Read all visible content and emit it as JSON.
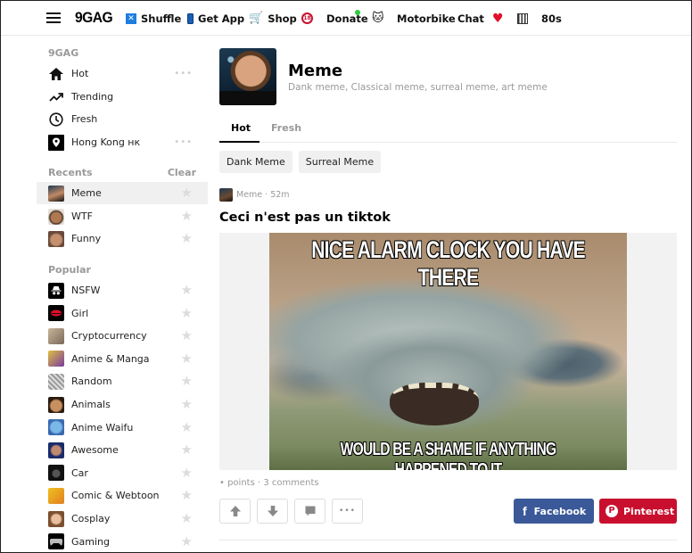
{
  "topbar": {
    "logo": "9GAG",
    "nav": [
      {
        "label": "Shuffle",
        "icon": "shuffle-icon"
      },
      {
        "label": "Get App",
        "icon": "phone-icon"
      },
      {
        "label": "Shop",
        "icon": "cart-icon"
      },
      {
        "label": "",
        "icon": "nsfw-18-icon"
      },
      {
        "label": "Donate",
        "icon": "",
        "notification_dot": true
      },
      {
        "label": "",
        "icon": "cat-icon"
      },
      {
        "label": "Motorbike",
        "icon": ""
      },
      {
        "label": "Chat",
        "icon": ""
      },
      {
        "label": "",
        "icon": "heart-icon"
      },
      {
        "label": "",
        "icon": "piano-icon"
      },
      {
        "label": "80s",
        "icon": ""
      }
    ],
    "glyphs": {
      "shuffle": "✕",
      "cart": "🛒",
      "eighteen": "18",
      "cat": "🐱",
      "heart": "♥"
    }
  },
  "sidebar": {
    "main_title": "9GAG",
    "main_items": [
      {
        "label": "Hot",
        "icon": "home-icon",
        "more": "•••"
      },
      {
        "label": "Trending",
        "icon": "trending-icon"
      },
      {
        "label": "Fresh",
        "icon": "clock-icon"
      },
      {
        "label": "Hong Kong нк",
        "icon": "location-icon",
        "more": "•••"
      }
    ],
    "recents_title": "Recents",
    "clear_label": "Clear",
    "recents": [
      {
        "label": "Meme",
        "active": true
      },
      {
        "label": "WTF"
      },
      {
        "label": "Funny"
      }
    ],
    "popular_title": "Popular",
    "popular": [
      {
        "label": "NSFW"
      },
      {
        "label": "Girl"
      },
      {
        "label": "Cryptocurrency"
      },
      {
        "label": "Anime & Manga"
      },
      {
        "label": "Random"
      },
      {
        "label": "Animals"
      },
      {
        "label": "Anime Waifu"
      },
      {
        "label": "Awesome"
      },
      {
        "label": "Car"
      },
      {
        "label": "Comic & Webtoon"
      },
      {
        "label": "Cosplay"
      },
      {
        "label": "Gaming"
      }
    ],
    "star_glyph": "★"
  },
  "section": {
    "title": "Meme",
    "description": "Dank meme, Classical meme, surreal meme, art meme",
    "tabs": [
      {
        "label": "Hot",
        "active": true
      },
      {
        "label": "Fresh",
        "active": false
      }
    ],
    "chips": [
      "Dank Meme",
      "Surreal Meme"
    ]
  },
  "post": {
    "meta": "Meme · 52m",
    "title": "Ceci n'est pas un tiktok",
    "image_top_text": "NICE ALARM CLOCK YOU HAVE THERE",
    "image_bottom_text": "WOULD BE A SHAME IF ANYTHING HAPPENED TO IT",
    "stats": "• points · 3 comments",
    "actions": {
      "more": "•••"
    },
    "share": {
      "facebook_label": "Facebook",
      "facebook_glyph": "f",
      "pinterest_label": "Pinterest",
      "pinterest_glyph": "P"
    }
  },
  "colors": {
    "facebook": "#3b5998",
    "pinterest": "#c8102e",
    "muted_text": "#999999",
    "active_row": "#f0f0f0"
  }
}
